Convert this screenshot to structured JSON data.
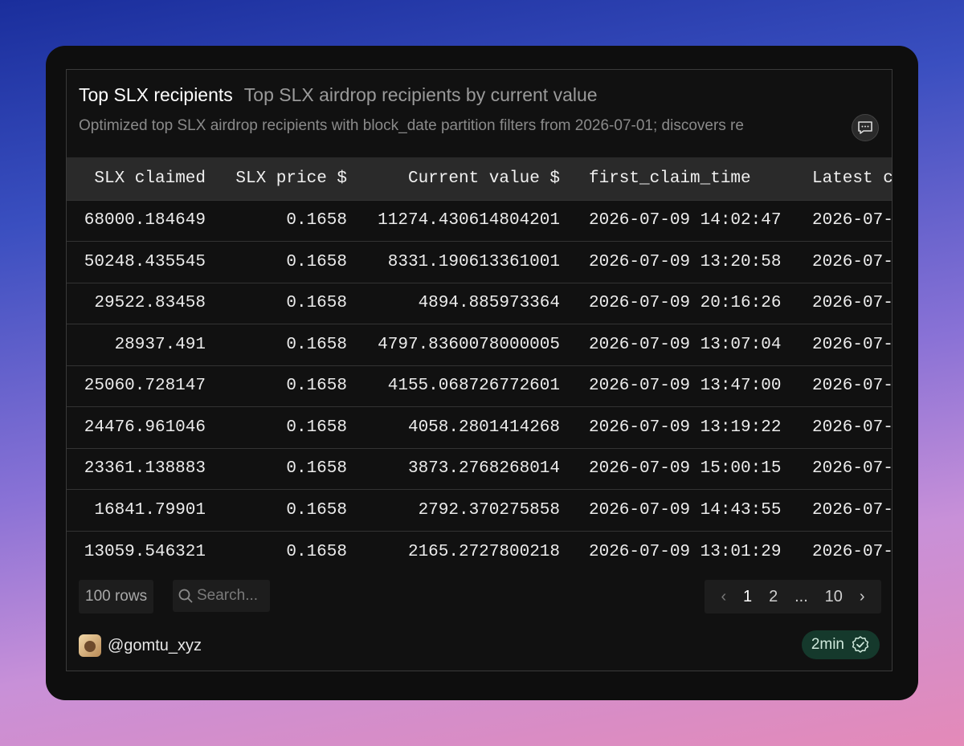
{
  "header": {
    "title": "Top SLX recipients",
    "subtitle": "Top SLX airdrop recipients by current value",
    "description": "Optimized top SLX airdrop recipients with block_date partition filters from 2026-07-01; discovers re"
  },
  "table": {
    "columns": [
      "SLX claimed",
      "SLX price $",
      "Current value $",
      "first_claim_time",
      "Latest c"
    ],
    "rows": [
      [
        "68000.184649",
        "0.1658",
        "11274.430614804201",
        "2026-07-09 14:02:47",
        "2026-07-"
      ],
      [
        "50248.435545",
        "0.1658",
        "8331.190613361001",
        "2026-07-09 13:20:58",
        "2026-07-"
      ],
      [
        "29522.83458",
        "0.1658",
        "4894.885973364",
        "2026-07-09 20:16:26",
        "2026-07-"
      ],
      [
        "28937.491",
        "0.1658",
        "4797.8360078000005",
        "2026-07-09 13:07:04",
        "2026-07-"
      ],
      [
        "25060.728147",
        "0.1658",
        "4155.068726772601",
        "2026-07-09 13:47:00",
        "2026-07-"
      ],
      [
        "24476.961046",
        "0.1658",
        "4058.2801414268",
        "2026-07-09 13:19:22",
        "2026-07-"
      ],
      [
        "23361.138883",
        "0.1658",
        "3873.2768268014",
        "2026-07-09 15:00:15",
        "2026-07-"
      ],
      [
        "16841.79901",
        "0.1658",
        "2792.370275858",
        "2026-07-09 14:43:55",
        "2026-07-"
      ],
      [
        "13059.546321",
        "0.1658",
        "2165.2727800218",
        "2026-07-09 13:01:29",
        "2026-07-"
      ]
    ]
  },
  "controls": {
    "rows_label": "100 rows",
    "search_placeholder": "Search...",
    "pages": [
      "1",
      "2",
      "...",
      "10"
    ]
  },
  "footer": {
    "author": "@gomtu_xyz",
    "refresh": "2min"
  },
  "colors": {
    "badge_bg": "#15392c",
    "card_bg": "#0e0e0e"
  }
}
